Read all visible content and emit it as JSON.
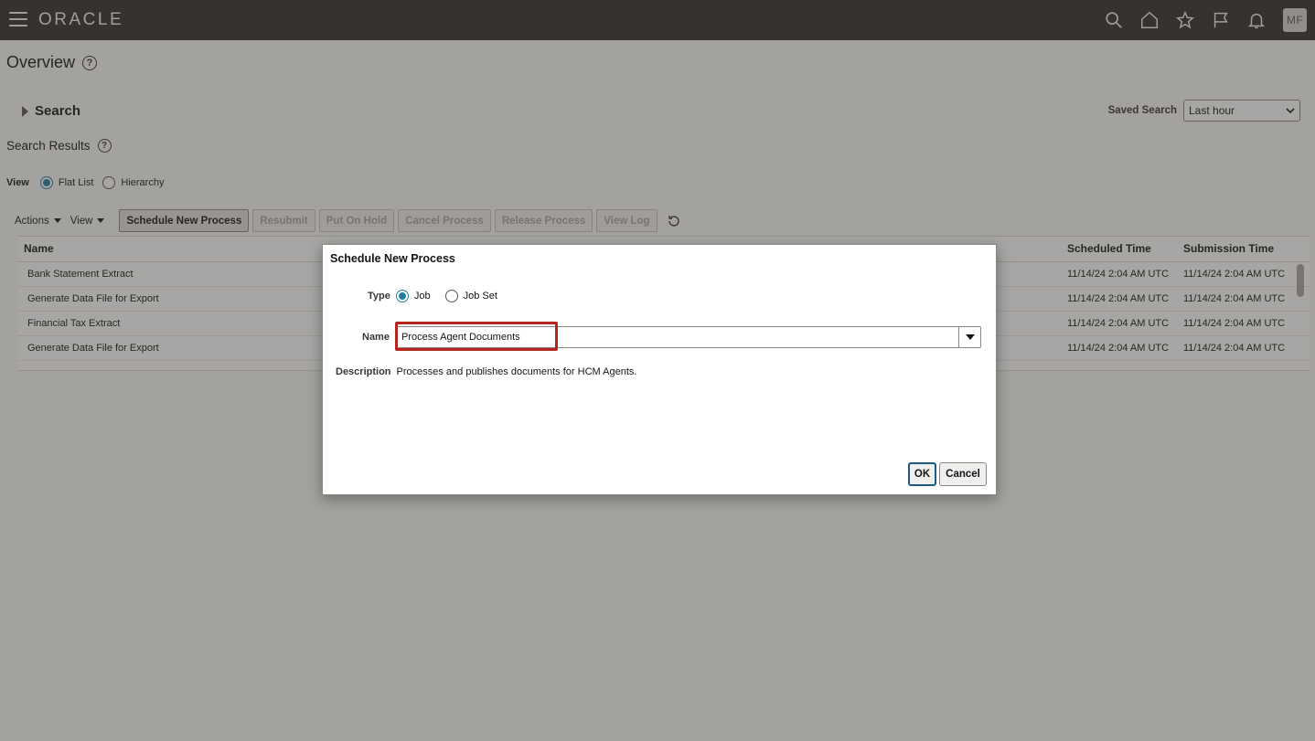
{
  "header": {
    "brand": "ORACLE",
    "avatar_initials": "MF",
    "icons": [
      "search-icon",
      "home-icon",
      "favorites-icon",
      "flag-icon",
      "bell-icon"
    ]
  },
  "page": {
    "title": "Overview",
    "search_label": "Search",
    "saved_search_label": "Saved Search",
    "saved_search_value": "Last hour",
    "results_title": "Search Results",
    "view_label": "View",
    "view_options": [
      "Flat List",
      "Hierarchy"
    ],
    "view_selected": "Flat List"
  },
  "toolbar": {
    "actions": "Actions",
    "view": "View",
    "buttons": [
      "Schedule New Process",
      "Resubmit",
      "Put On Hold",
      "Cancel Process",
      "Release Process",
      "View Log"
    ]
  },
  "table": {
    "columns": [
      "Name",
      "Scheduled Time",
      "Submission Time"
    ],
    "rows": [
      {
        "name": "Bank Statement Extract",
        "scheduled": "11/14/24 2:04 AM UTC",
        "submitted": "11/14/24 2:04 AM UTC"
      },
      {
        "name": "Generate Data File for Export",
        "scheduled": "11/14/24 2:04 AM UTC",
        "submitted": "11/14/24 2:04 AM UTC"
      },
      {
        "name": "Financial Tax Extract",
        "scheduled": "11/14/24 2:04 AM UTC",
        "submitted": "11/14/24 2:04 AM UTC"
      },
      {
        "name": "Generate Data File for Export",
        "scheduled": "11/14/24 2:04 AM UTC",
        "submitted": "11/14/24 2:04 AM UTC"
      }
    ]
  },
  "dialog": {
    "title": "Schedule New Process",
    "type_label": "Type",
    "type_options": [
      "Job",
      "Job Set"
    ],
    "type_selected": "Job",
    "name_label": "Name",
    "name_value": "Process Agent Documents",
    "description_label": "Description",
    "description_value": "Processes and publishes documents for HCM Agents.",
    "ok_label": "OK",
    "cancel_label": "Cancel",
    "highlight_color": "#b3261e"
  }
}
